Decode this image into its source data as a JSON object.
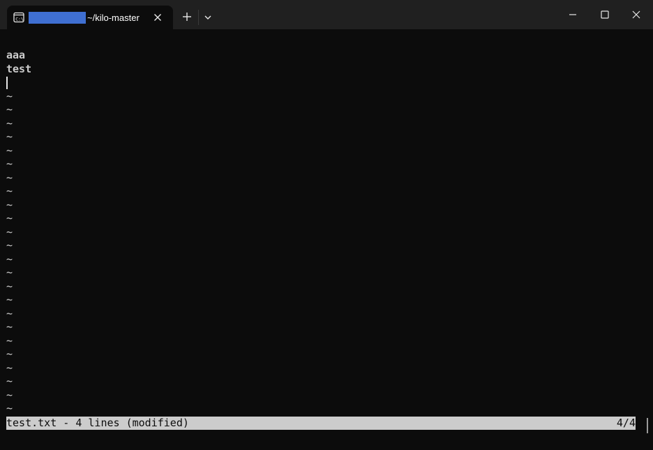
{
  "window": {
    "tab_title": "~/kilo-master",
    "tab_icon": "terminal-icon",
    "colors": {
      "titlebar": "#202020",
      "terminal_bg": "#0c0c0c",
      "text": "#cccccc",
      "status_bar_bg": "#cccccc",
      "redacted": "#3f6fd1"
    }
  },
  "editor": {
    "lines": [
      "aaa",
      "test"
    ],
    "empty_marker": "~",
    "empty_line_count": 24
  },
  "status_bar": {
    "left": "test.txt - 4 lines (modified)",
    "right": "4/4"
  }
}
